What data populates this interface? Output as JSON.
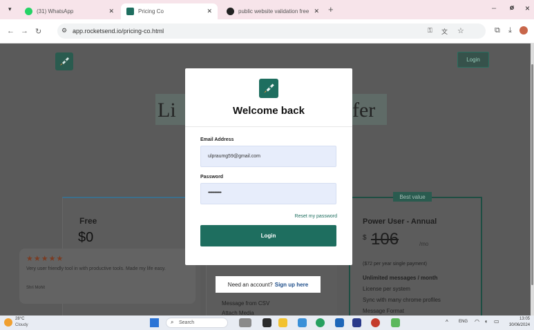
{
  "browser": {
    "tabs": [
      {
        "title": "(31) WhatsApp",
        "icon": "whatsapp-icon",
        "active": false
      },
      {
        "title": "Pricing Co",
        "icon": "rocket-favicon",
        "active": true
      },
      {
        "title": "public website validation free",
        "icon": "chatgpt-icon",
        "active": false
      }
    ],
    "new_tab": "+",
    "url": "app.rocketsend.io/pricing-co.html",
    "window": {
      "minimize": "–",
      "close": "×"
    }
  },
  "page": {
    "heading_left": "Li",
    "heading_right": "fer",
    "nav_login": "Login",
    "plans": [
      {
        "name": "Free",
        "price": "$0"
      },
      {
        "name": "Power User - Annual",
        "badge": "Best value",
        "currency": "$",
        "price": "106",
        "per": "/mo",
        "note": "($72 per year single payment)",
        "features": [
          "Unlimited messages / month",
          "License per system",
          "Sync with many chrome profiles",
          "Message Format"
        ]
      }
    ],
    "middle_features": [
      "Message from CSV",
      "Attach Media"
    ],
    "testimonial": {
      "stars": "★★★★★",
      "text": "Very user friendly tool in with productive tools. Made my life easy.",
      "author": "Shri Mohit"
    }
  },
  "modal": {
    "title": "Welcome back",
    "email_label": "Email Address",
    "email_value": "ulpraumg59@gmail.com",
    "password_label": "Password",
    "password_value": "•••••••••••••",
    "reset_link": "Reset my password",
    "login_button": "Login",
    "signup_prefix": "Need an account?",
    "signup_link": "Sign up here"
  },
  "taskbar": {
    "weather_temp": "28°C",
    "weather_desc": "Cloudy",
    "search_placeholder": "Search",
    "lang": "ENG",
    "time": "13:05",
    "date": "30/06/2024"
  },
  "colors": {
    "brand": "#1e6e5f",
    "tabbar": "#f7e4ea",
    "overlay": "#5a5a5a"
  }
}
